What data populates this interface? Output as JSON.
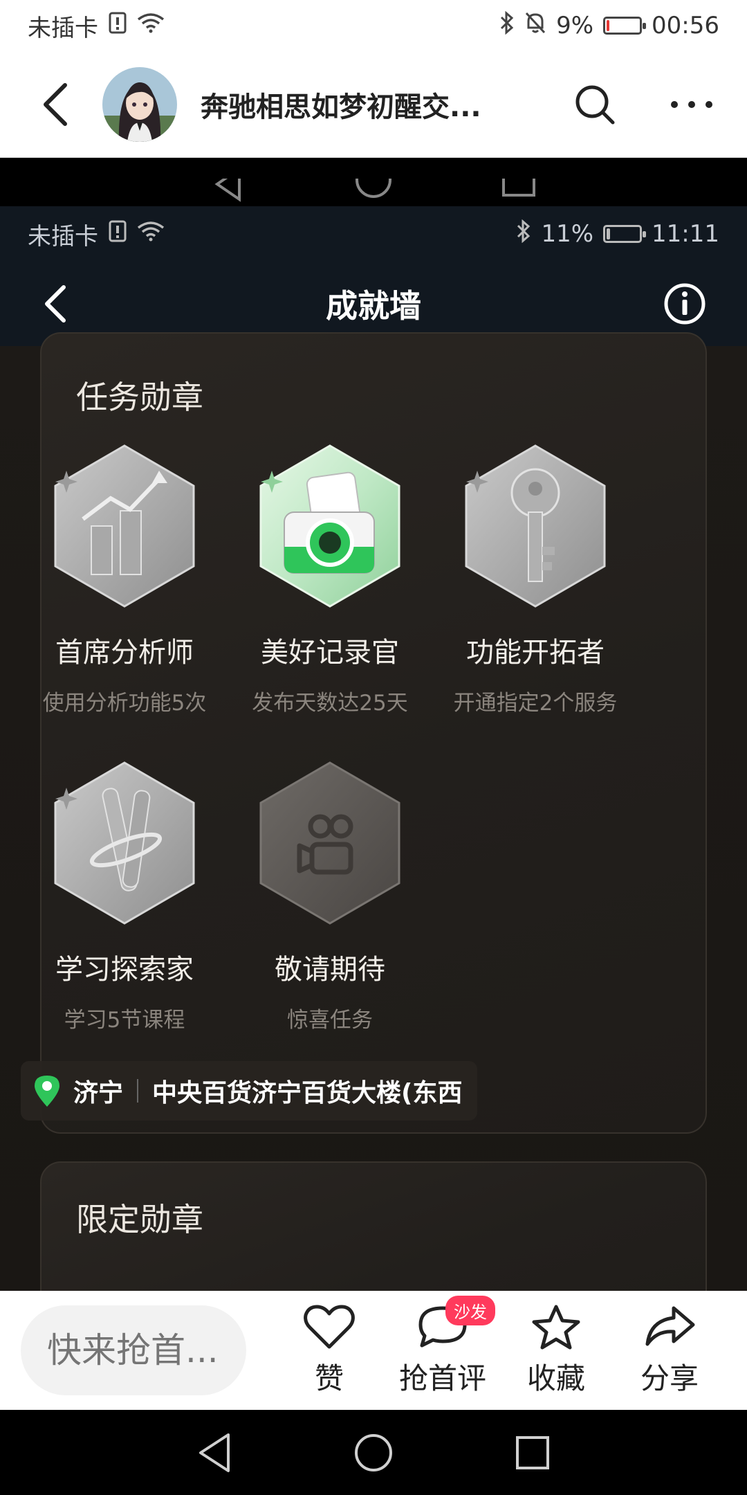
{
  "outer_status": {
    "carrier": "未插卡",
    "battery": "9%",
    "time": "00:56",
    "battery_level": 0.09
  },
  "outer_header": {
    "title": "奔驰相思如梦初醒交..."
  },
  "inner_status": {
    "carrier": "未插卡",
    "battery": "11%",
    "time": "11:11",
    "battery_level": 0.11
  },
  "inner_header": {
    "title": "成就墙"
  },
  "task_medals": {
    "title": "任务勋章",
    "items": [
      {
        "name": "首席分析师",
        "desc": "使用分析功能5次",
        "icon": "chart-icon"
      },
      {
        "name": "美好记录官",
        "desc": "发布天数达25天",
        "icon": "camera-icon"
      },
      {
        "name": "功能开拓者",
        "desc": "开通指定2个服务",
        "icon": "key-icon"
      },
      {
        "name": "学习探索家",
        "desc": "学习5节课程",
        "icon": "scroll-icon"
      },
      {
        "name": "敬请期待",
        "desc": "惊喜任务",
        "icon": "kuaishou-icon"
      }
    ]
  },
  "limited_medals": {
    "title": "限定勋章"
  },
  "location": {
    "city": "济宁",
    "place": "中央百货济宁百货大楼(东西"
  },
  "comment": {
    "placeholder": "快来抢首..."
  },
  "actions": {
    "like": "赞",
    "comment": "抢首评",
    "comment_badge": "沙发",
    "favorite": "收藏",
    "share": "分享"
  },
  "colors": {
    "accent_green": "#2fc55a",
    "badge_pink": "#ff3a5c"
  }
}
